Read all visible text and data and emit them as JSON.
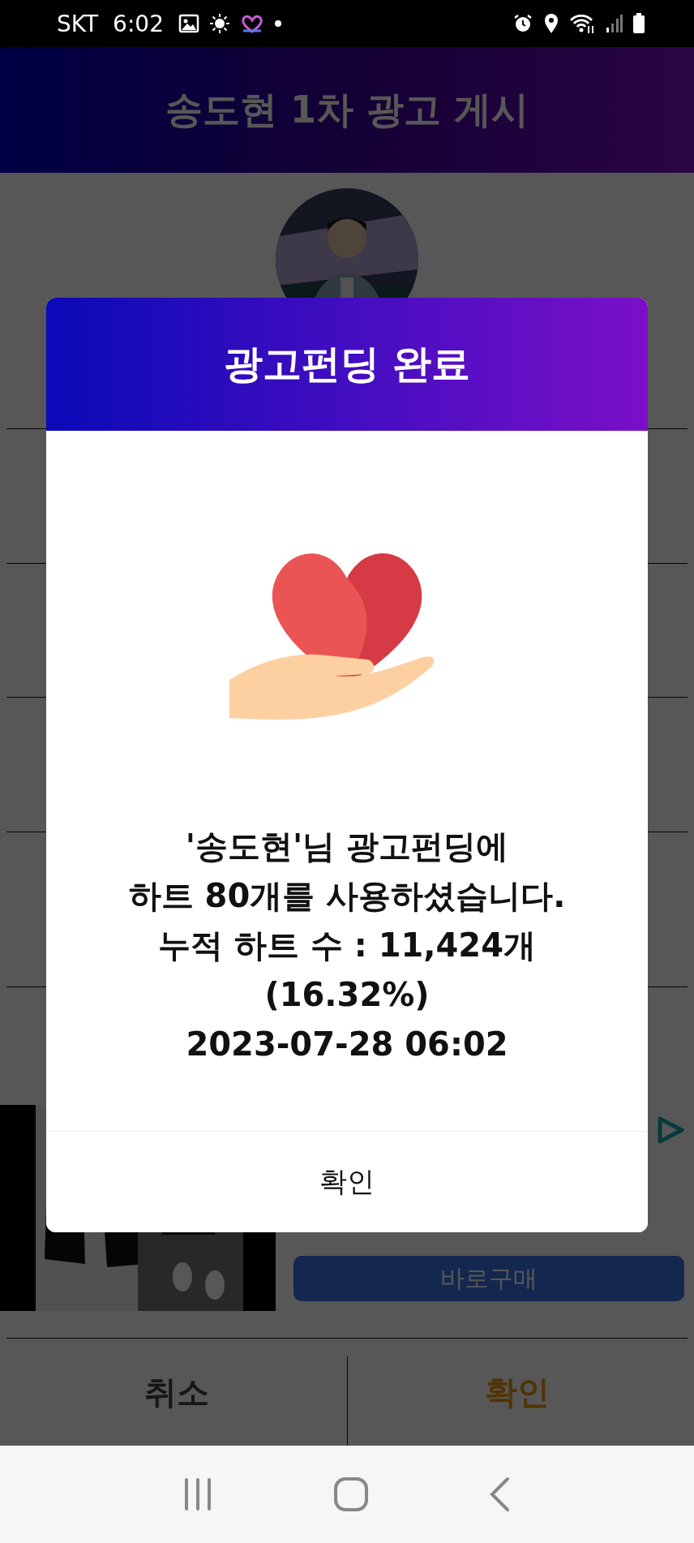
{
  "status_bar": {
    "carrier": "SKT",
    "time": "6:02"
  },
  "header": {
    "title": "송도현 1차 광고 게시"
  },
  "ad": {
    "button": "바로구매"
  },
  "footer_buttons": [
    {
      "label": "취소",
      "kind": "cancel"
    },
    {
      "label": "확인",
      "kind": "confirm"
    }
  ],
  "dialog": {
    "title": "광고펀딩 완료",
    "message_lines": [
      "'송도현'님 광고펀딩에",
      "하트 80개를 사용하셨습니다.",
      "누적 하트 수 : 11,424개",
      "(16.32%)",
      "2023-07-28 06:02"
    ],
    "button": "확인"
  }
}
